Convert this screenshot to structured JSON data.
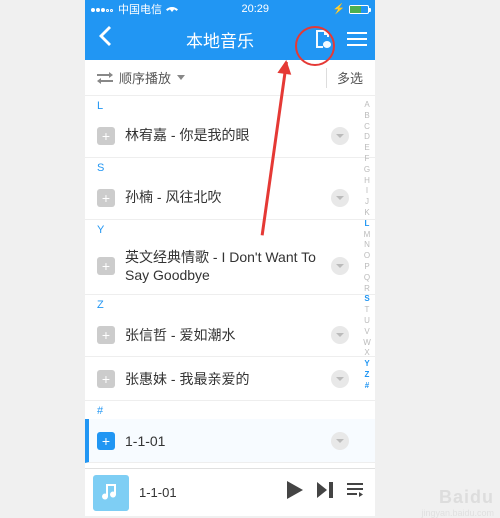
{
  "status": {
    "carrier": "中国电信",
    "time": "20:29"
  },
  "nav": {
    "title": "本地音乐"
  },
  "subbar": {
    "shuffle": "顺序播放",
    "multiselect": "多选"
  },
  "sections": [
    {
      "letter": "L",
      "songs": [
        {
          "title": "林宥嘉 - 你是我的眼"
        }
      ]
    },
    {
      "letter": "S",
      "songs": [
        {
          "title": "孙楠 - 风往北吹"
        }
      ]
    },
    {
      "letter": "Y",
      "songs": [
        {
          "title": "英文经典情歌 - I Don't Want To Say Goodbye"
        }
      ]
    },
    {
      "letter": "Z",
      "songs": [
        {
          "title": "张信哲 - 爱如潮水"
        },
        {
          "title": "张惠妹 - 我最亲爱的"
        }
      ]
    },
    {
      "letter": "#",
      "songs": [
        {
          "title": "1-1-01",
          "playing": true
        }
      ]
    }
  ],
  "alpha_index": [
    "A",
    "B",
    "C",
    "D",
    "E",
    "F",
    "G",
    "H",
    "I",
    "J",
    "K",
    "L",
    "M",
    "N",
    "O",
    "P",
    "Q",
    "R",
    "S",
    "T",
    "U",
    "V",
    "W",
    "X",
    "Y",
    "Z",
    "#"
  ],
  "alpha_active": [
    "L",
    "S",
    "Y",
    "Z",
    "#"
  ],
  "player": {
    "now_playing": "1-1-01"
  },
  "watermark": {
    "main": "Baidu",
    "sub": "jingyan.baidu.com"
  }
}
